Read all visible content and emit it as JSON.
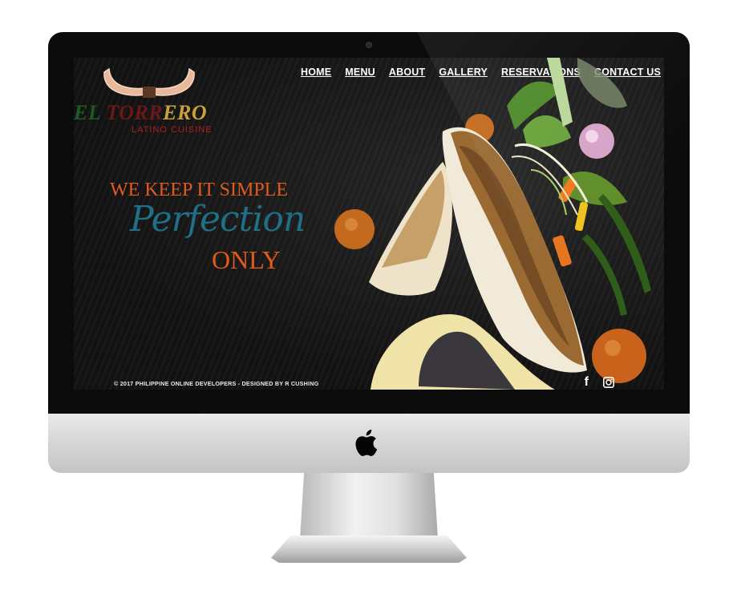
{
  "logo": {
    "part1": "EL ",
    "part2": "TORR",
    "part3": "ERO",
    "subtitle": "LATINO CUISINE"
  },
  "nav": {
    "items": [
      "HOME",
      "MENU",
      "ABOUT",
      "GALLERY",
      "RESERVATIONS",
      "CONTACT US"
    ]
  },
  "hero": {
    "tagline": "WE KEEP IT SIMPLE",
    "script": "Perfection",
    "only": "ONLY"
  },
  "footer": {
    "copyright": "© 2017 PHILIPPINE ONLINE DEVELOPERS - DESIGNED BY R CUSHING",
    "facebook_glyph": "f",
    "icons": [
      "facebook-icon",
      "instagram-icon"
    ]
  },
  "colors": {
    "accent_orange": "#e05a1e",
    "script_teal": "#1f6f86",
    "logo_green": "#1f5a22",
    "logo_red": "#6a1818",
    "logo_gold": "#c9a23a"
  }
}
